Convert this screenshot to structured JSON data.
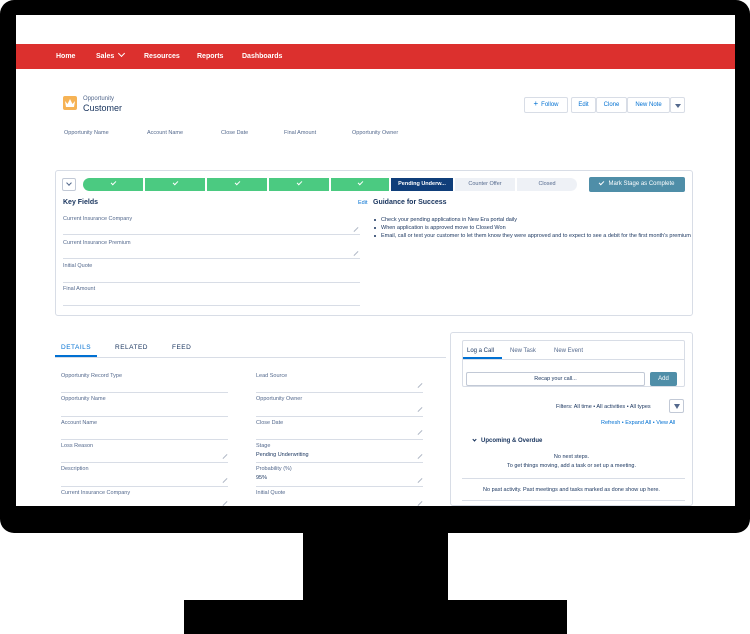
{
  "nav": {
    "items": [
      {
        "label": "Home"
      },
      {
        "label": "Sales"
      },
      {
        "label": "Resources"
      },
      {
        "label": "Reports"
      },
      {
        "label": "Dashboards"
      }
    ]
  },
  "header": {
    "object_type": "Opportunity",
    "record_name": "Customer",
    "buttons": {
      "follow": "Follow",
      "edit": "Edit",
      "clone": "Clone",
      "new_note": "New Note"
    },
    "highlights": [
      "Opportunity Name",
      "Account Name",
      "Close Date",
      "Final Amount",
      "Opportunity Owner"
    ]
  },
  "path": {
    "stages": [
      {
        "label": "",
        "state": "done"
      },
      {
        "label": "",
        "state": "done"
      },
      {
        "label": "",
        "state": "done"
      },
      {
        "label": "",
        "state": "done"
      },
      {
        "label": "",
        "state": "done"
      },
      {
        "label": "Pending Underw...",
        "state": "current"
      },
      {
        "label": "Counter Offer",
        "state": "todo"
      },
      {
        "label": "Closed",
        "state": "todo"
      }
    ],
    "mark_complete": "Mark Stage as Complete",
    "key_fields_title": "Key Fields",
    "edit": "Edit",
    "key_fields": [
      "Current Insurance Company",
      "Current Insurance Premium",
      "Initial Quote",
      "Final Amount"
    ],
    "guidance_title": "Guidance for Success",
    "guidance": [
      "Check your pending applications in New Era portal daily",
      "When application is approved move to Closed Won",
      "Email, call or text your customer to let them know they were approved and to expect to see a debit for the first month's premium"
    ]
  },
  "details": {
    "tabs": {
      "details": "DETAILS",
      "related": "RELATED",
      "feed": "FEED"
    },
    "left_fields": [
      {
        "label": "Opportunity Record Type",
        "value": ""
      },
      {
        "label": "Opportunity Name",
        "value": ""
      },
      {
        "label": "Account Name",
        "value": ""
      },
      {
        "label": "Loss Reason",
        "value": ""
      },
      {
        "label": "Description",
        "value": ""
      },
      {
        "label": "Current Insurance Company",
        "value": ""
      }
    ],
    "right_fields": [
      {
        "label": "Lead Source",
        "value": ""
      },
      {
        "label": "Opportunity Owner",
        "value": ""
      },
      {
        "label": "Close Date",
        "value": ""
      },
      {
        "label": "Stage",
        "value": "Pending Underwriting"
      },
      {
        "label": "Probability (%)",
        "value": "95%"
      },
      {
        "label": "Initial Quote",
        "value": ""
      }
    ]
  },
  "activity": {
    "tabs": {
      "log_call": "Log a Call",
      "new_task": "New Task",
      "new_event": "New Event"
    },
    "recap_placeholder": "Recap your call...",
    "add": "Add",
    "filters": "Filters: All time • All activities • All types",
    "links": "Refresh • Expand All • View All",
    "upcoming": "Upcoming & Overdue",
    "no_steps": "No next steps.",
    "no_steps_hint": "To get things moving, add a task or set up a meeting.",
    "no_past": "No past activity. Past meetings and tasks marked as done show up here."
  },
  "colors": {
    "nav_red": "#dc302e",
    "stage_done": "#4bca81",
    "stage_current": "#0f3e7a",
    "brand_button": "#4f8ea8",
    "link_blue": "#0070d2"
  }
}
